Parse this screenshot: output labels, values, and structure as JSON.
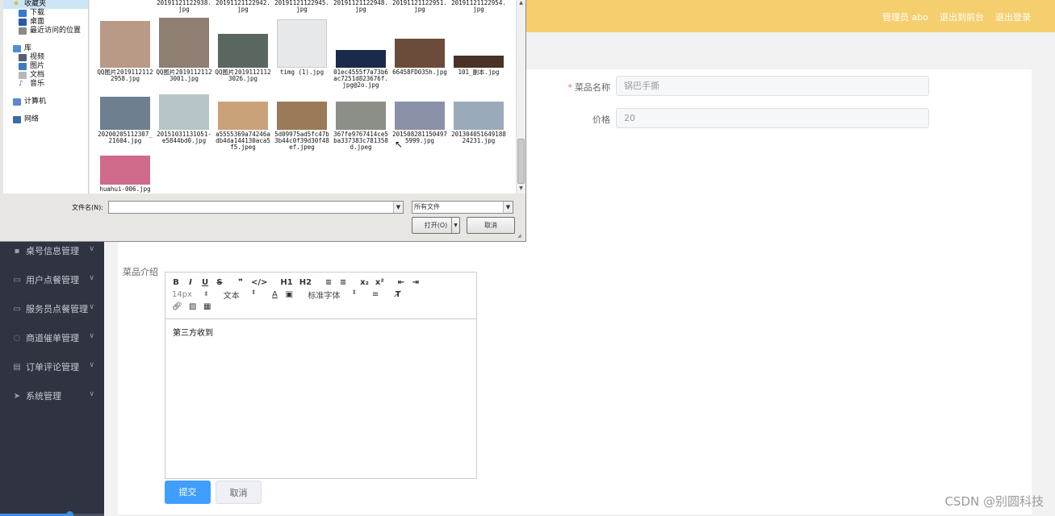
{
  "topbar": {
    "admin_label": "管理员 abo",
    "back_to_front": "退出到前台",
    "logout": "退出登录",
    "color": "#f5cf6e"
  },
  "sidebar": {
    "items": [
      {
        "label": "桌号信息管理",
        "icon": "comment-icon"
      },
      {
        "label": "用户点餐管理",
        "icon": "monitor-icon"
      },
      {
        "label": "服务员点餐管理",
        "icon": "monitor-icon"
      },
      {
        "label": "商道催单管理",
        "icon": "clock-icon"
      },
      {
        "label": "订单评论管理",
        "icon": "printer-icon"
      },
      {
        "label": "系统管理",
        "icon": "send-icon"
      }
    ],
    "progress": 0.67
  },
  "form": {
    "dish_name_label": "菜品名称",
    "dish_name_value": "锅巴手撕",
    "price_label": "价格",
    "price_value": "20",
    "intro_label": "菜品介绍",
    "editor_content": "第三方收到",
    "toolbar": {
      "row1": [
        "B",
        "I",
        "U",
        "S",
        "❞",
        "</>",
        "H1",
        "H2",
        "≡",
        "≡",
        "x₂",
        "x²",
        "⇤",
        "⇥"
      ],
      "font_size": "14px",
      "text_type": "文本",
      "font_family": "标准字体"
    },
    "submit_label": "提交",
    "cancel_label": "取消"
  },
  "watermark": "CSDN @别圆科技",
  "dialog": {
    "nav": {
      "favorites": "收藏夹",
      "downloads": "下载",
      "desktop": "桌面",
      "recent": "最近访问的位置",
      "library": "库",
      "videos": "视频",
      "pictures": "图片",
      "documents": "文档",
      "music": "音乐",
      "computer": "计算机",
      "network": "网络"
    },
    "top_row": [
      "20191121122938.jpg",
      "20191121122942.jpg",
      "20191121122945.jpg",
      "20191121122948.jpg",
      "20191121122951.jpg",
      "20191121122954.jpg"
    ],
    "files_row1": [
      {
        "name": "QQ图片20191121122958.jpg",
        "color": "#b89a86"
      },
      {
        "name": "QQ图片20191121123001.jpg",
        "color": "#8e7f72"
      },
      {
        "name": "QQ图片20191121123026.jpg",
        "color": "#5a6660"
      },
      {
        "name": "timg (1).jpg",
        "color": "#e6e8ea"
      },
      {
        "name": "01ec4555f7a73b6ac7251d823676f.jpg@2o.jpg",
        "color": "#1a2a4a"
      },
      {
        "name": "66458FD035h.jpg",
        "color": "#6b4b3a"
      },
      {
        "name": "101_副本.jpg",
        "color": "#4a3324"
      }
    ],
    "files_row2": [
      {
        "name": "20200205112307_21604.jpg",
        "color": "#6e8090"
      },
      {
        "name": "20151031131051-e5844bd0.jpg",
        "color": "#b7c4c8"
      },
      {
        "name": "a5555369a74246adb4da144130aca5f5.jpeg",
        "color": "#c9a27a"
      },
      {
        "name": "5d09975ad5fc47b3b44c0f39d30f48ef.jpeg",
        "color": "#9a7a58"
      },
      {
        "name": "367fe9767414ce5ba337383c781358d.jpeg",
        "color": "#8c8f88"
      },
      {
        "name": "2015082811504975999.jpg",
        "color": "#8a90a8"
      },
      {
        "name": "20130405164918824231.jpg",
        "color": "#9aaabb"
      }
    ],
    "files_row3": [
      {
        "name": "huahui-006.jpg",
        "color": "#d06a8a"
      }
    ],
    "filename_label": "文件名(N):",
    "filename_value": "",
    "filetype": "所有文件",
    "open_label": "打开(O)",
    "cancel_label": "取消"
  }
}
